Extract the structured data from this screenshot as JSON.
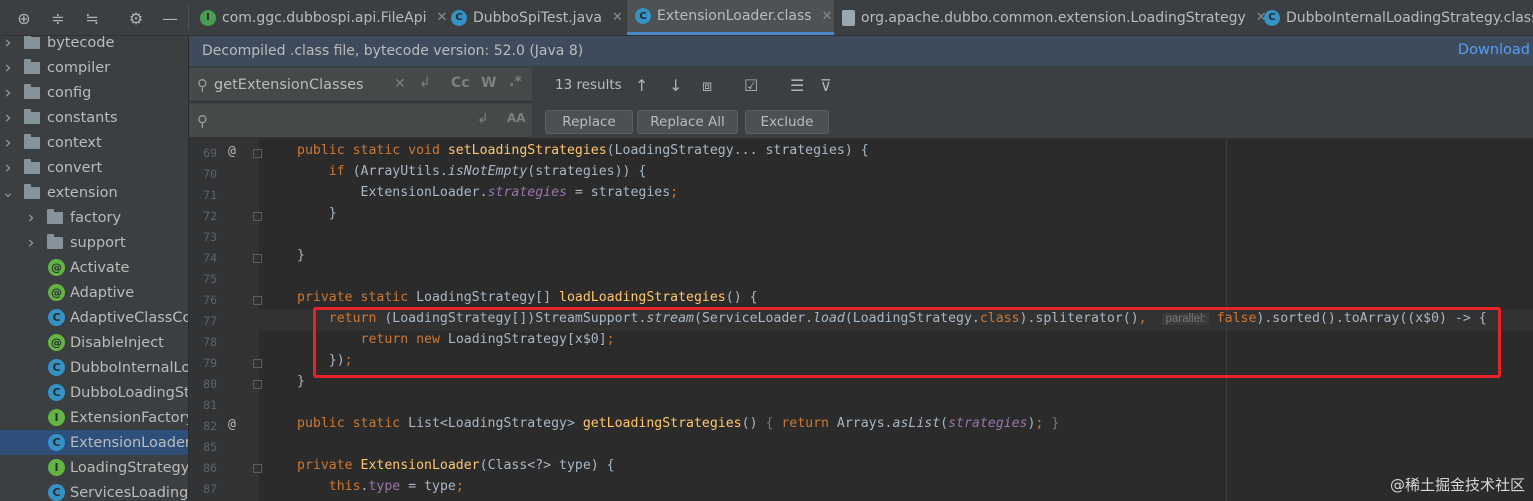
{
  "tabs": [
    {
      "label": "com.ggc.dubbospi.api.FileApi",
      "icon": "java-interface-icon",
      "color": "#499c54",
      "letter": "I"
    },
    {
      "label": "DubboSpiTest.java",
      "icon": "java-class-icon",
      "color": "#3592c4",
      "letter": "C"
    },
    {
      "label": "ExtensionLoader.class",
      "icon": "java-class-icon",
      "color": "#3592c4",
      "letter": "C"
    },
    {
      "label": "org.apache.dubbo.common.extension.LoadingStrategy",
      "icon": "file-icon",
      "color": "#9aa7b0",
      "letter": ""
    },
    {
      "label": "DubboInternalLoadingStrategy.class",
      "icon": "java-class-icon",
      "color": "#3592c4",
      "letter": "C"
    }
  ],
  "tree": [
    {
      "label": "bytecode",
      "type": "folder",
      "depth": 0,
      "expanded": false
    },
    {
      "label": "compiler",
      "type": "folder",
      "depth": 0,
      "expanded": false
    },
    {
      "label": "config",
      "type": "folder",
      "depth": 0,
      "expanded": false
    },
    {
      "label": "constants",
      "type": "folder",
      "depth": 0,
      "expanded": false
    },
    {
      "label": "context",
      "type": "folder",
      "depth": 0,
      "expanded": false
    },
    {
      "label": "convert",
      "type": "folder",
      "depth": 0,
      "expanded": false
    },
    {
      "label": "extension",
      "type": "folder",
      "depth": 0,
      "expanded": true
    },
    {
      "label": "factory",
      "type": "folder",
      "depth": 1,
      "expanded": false
    },
    {
      "label": "support",
      "type": "folder",
      "depth": 1,
      "expanded": false
    },
    {
      "label": "Activate",
      "type": "annotation",
      "depth": 1
    },
    {
      "label": "Adaptive",
      "type": "annotation",
      "depth": 1
    },
    {
      "label": "AdaptiveClassCodeGenerator",
      "type": "class",
      "depth": 1
    },
    {
      "label": "DisableInject",
      "type": "annotation",
      "depth": 1
    },
    {
      "label": "DubboInternalLoadingStrategy",
      "type": "class",
      "depth": 1
    },
    {
      "label": "DubboLoadingStrategy",
      "type": "class",
      "depth": 1
    },
    {
      "label": "ExtensionFactory",
      "type": "interface",
      "depth": 1
    },
    {
      "label": "ExtensionLoader",
      "type": "class",
      "depth": 1,
      "selected": true
    },
    {
      "label": "LoadingStrategy",
      "type": "interface",
      "depth": 1
    },
    {
      "label": "ServicesLoadingStrategy",
      "type": "class",
      "depth": 1
    }
  ],
  "banner": {
    "text": "Decompiled .class file, bytecode version: 52.0 (Java 8)",
    "link": "Download"
  },
  "find": {
    "search_value": "getExtensionClasses",
    "results": "13 results",
    "replace_label": "Replace",
    "replace_all_label": "Replace All",
    "exclude_label": "Exclude",
    "case_toggle": "Cc",
    "word_toggle": "W",
    "regex_toggle": ".*",
    "preserve_case": "AA"
  },
  "code": {
    "line_numbers": [
      "69",
      "70",
      "71",
      "72",
      "73",
      "74",
      "75",
      "76",
      "77",
      "78",
      "79",
      "80",
      "81",
      "82",
      "85",
      "86",
      "87"
    ],
    "lines": [
      "<span class=\"kw\">public static void </span><span class=\"fn\">setLoadingStrategies</span>(LoadingStrategy... strategies) {",
      "    <span class=\"kw\">if </span>(ArrayUtils.<span class=\"it\">isNotEmpty</span>(strategies)) {",
      "        ExtensionLoader.<span class=\"fld\">strategies</span> = strategies<span class=\"kw\">;</span>",
      "    }",
      "",
      "}",
      "",
      "<span class=\"kw\">private static </span>LoadingStrategy[] <span class=\"fn\">loadLoadingStrategies</span>() {",
      "    <span class=\"kw\">return </span>(LoadingStrategy[])StreamSupport.<span class=\"it\">stream</span>(ServiceLoader.<span class=\"it\">load</span>(LoadingStrategy.<span class=\"kw\">class</span>).spliterator()<span class=\"kw\">, </span> <span class=\"hint\">parallel:</span> <span class=\"kw\">false</span>).sorted().toArray((x$0) -> {",
      "        <span class=\"kw\">return new </span>LoadingStrategy[x$0]<span class=\"kw\">;</span>",
      "    })<span class=\"kw\">;</span>",
      "}",
      "",
      "<span class=\"kw\">public static </span>List&lt;LoadingStrategy&gt; <span class=\"fn\">getLoadingStrategies</span>() <span class=\"dim\">{ </span><span class=\"kw\">return </span>Arrays.<span class=\"it\">asList</span>(<span class=\"fld\">strategies</span>)<span class=\"kw\">; </span><span class=\"dim\">}</span>",
      "",
      "<span class=\"kw\">private </span><span class=\"fn\">ExtensionLoader</span>(Class&lt;?&gt; type) {",
      "    <span class=\"kw\">this</span>.<span class=\"fld\" style=\"font-style:normal\">type</span> = type<span class=\"kw\">;</span>"
    ],
    "gutter_marks": {
      "69": "@",
      "82": "@"
    }
  },
  "watermark": "@稀土掘金技术社区"
}
